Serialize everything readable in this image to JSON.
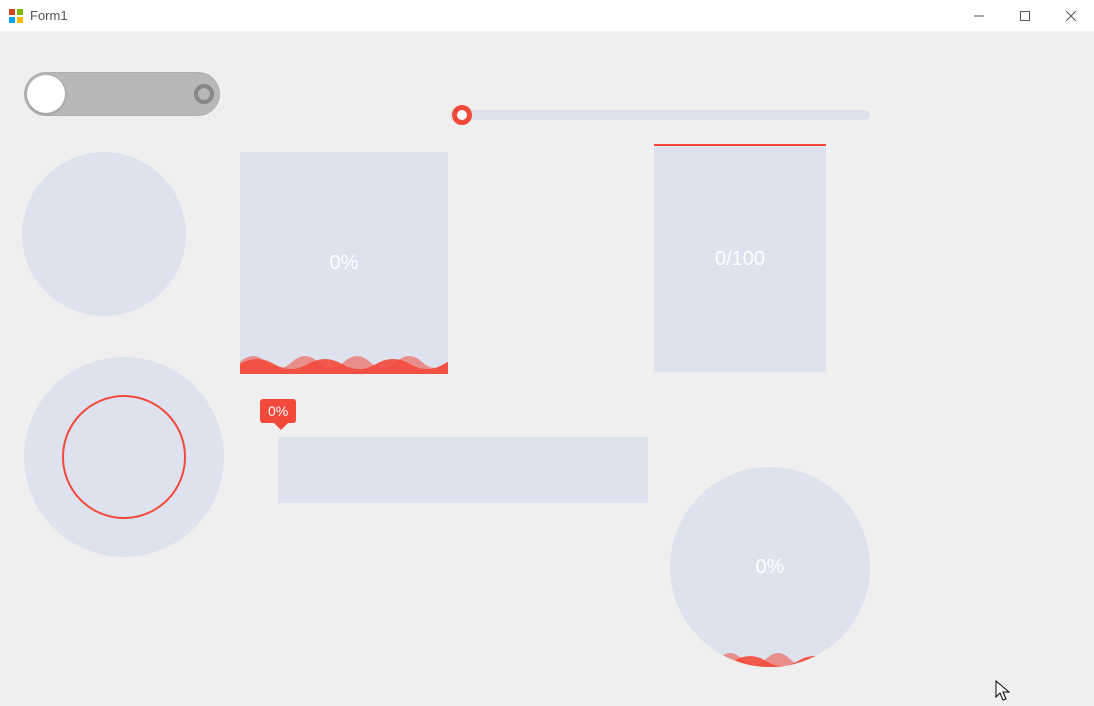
{
  "window": {
    "title": "Form1"
  },
  "toggle": {
    "state": "off"
  },
  "slider": {
    "value": 0
  },
  "wavebox": {
    "percent_label": "0%"
  },
  "wavebox_fraction": {
    "fraction_label": "0/100"
  },
  "progressbar": {
    "tooltip_label": "0%",
    "value": 0
  },
  "wavecircle": {
    "percent_label": "0%"
  },
  "colors": {
    "accent": "#f24a3a",
    "tile": "#dde2ee",
    "bg": "#efefef"
  }
}
